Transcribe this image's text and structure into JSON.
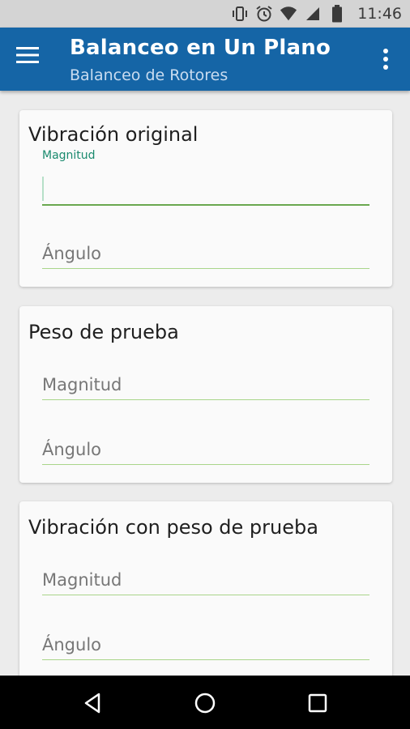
{
  "status_bar": {
    "time": "11:46",
    "icons": [
      "vibrate-icon",
      "alarm-icon",
      "wifi-icon",
      "signal-icon",
      "battery-icon"
    ]
  },
  "app_bar": {
    "title": "Balanceo en Un Plano",
    "subtitle": "Balanceo de Rotores",
    "menu_icon": "hamburger-menu-icon",
    "overflow_icon": "more-vert-icon",
    "color": "#1565a6"
  },
  "cards": [
    {
      "title": "Vibración original",
      "fields": [
        {
          "label": "Magnitud",
          "value": "",
          "focused": true
        },
        {
          "label": "Ángulo",
          "value": "",
          "focused": false
        }
      ]
    },
    {
      "title": "Peso de prueba",
      "fields": [
        {
          "label": "Magnitud",
          "value": "",
          "focused": false
        },
        {
          "label": "Ángulo",
          "value": "",
          "focused": false
        }
      ]
    },
    {
      "title": "Vibración con peso de prueba",
      "fields": [
        {
          "label": "Magnitud",
          "value": "",
          "focused": false
        },
        {
          "label": "Ángulo",
          "value": "",
          "focused": false
        }
      ]
    }
  ],
  "nav_bar": {
    "icons": [
      "back-icon",
      "home-icon",
      "recents-icon"
    ]
  },
  "colors": {
    "accent_line": "#a9d58a",
    "focused_line": "#6aa84f",
    "float_label": "#1a8a6e"
  }
}
